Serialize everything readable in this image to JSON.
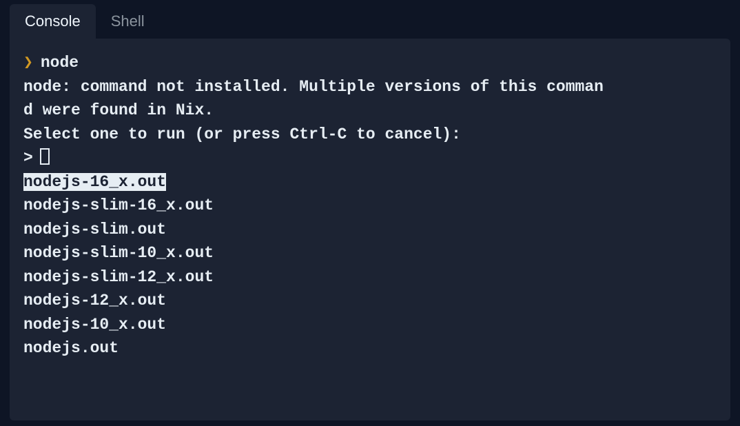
{
  "tabs": {
    "console": "Console",
    "shell": "Shell"
  },
  "terminal": {
    "prompt_symbol": "❯",
    "command": "node",
    "error_line1": "node: command not installed. Multiple versions of this comman",
    "error_line2": "d were found in Nix.",
    "instruction": "Select one to run (or press Ctrl-C to cancel):",
    "caret": ">",
    "options": [
      "nodejs-16_x.out",
      "nodejs-slim-16_x.out",
      "nodejs-slim.out",
      "nodejs-slim-10_x.out",
      "nodejs-slim-12_x.out",
      "nodejs-12_x.out",
      "nodejs-10_x.out",
      "nodejs.out"
    ],
    "selected_index": 0
  }
}
